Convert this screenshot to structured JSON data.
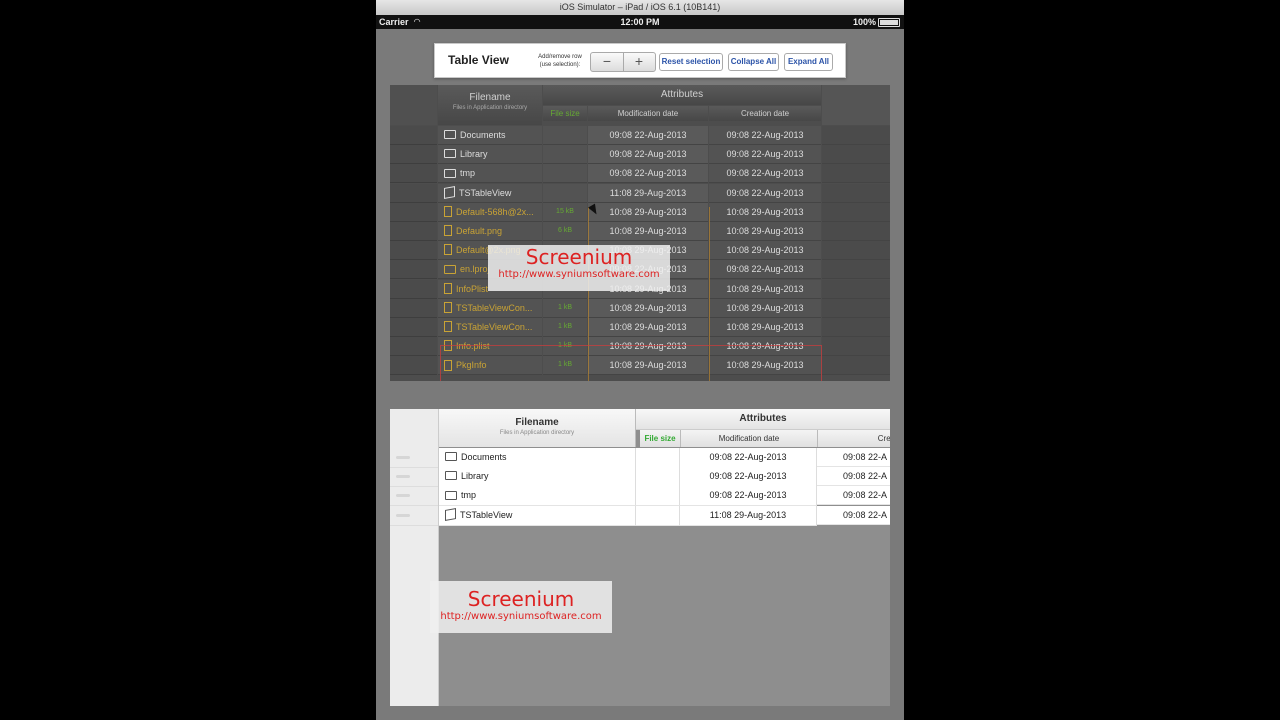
{
  "window": {
    "title": "iOS Simulator – iPad / iOS 6.1 (10B141)"
  },
  "status_bar": {
    "carrier": "Carrier",
    "time": "12:00 PM",
    "battery": "100%"
  },
  "toolbar": {
    "title": "Table View",
    "add_remove_label_1": "Add/remove row",
    "add_remove_label_2": "(use selection):",
    "minus": "−",
    "plus": "+",
    "reset_selection": "Reset selection",
    "collapse_all": "Collapse All",
    "expand_all": "Expand All"
  },
  "table_top": {
    "header_filename": "Filename",
    "header_filename_sub": "Files in Application directory",
    "header_attributes": "Attributes",
    "header_file_size": "File size",
    "header_modification": "Modification date",
    "header_creation": "Creation date",
    "rows": [
      {
        "name": "Documents",
        "icon": "folder-icon",
        "size": "",
        "mod": "09:08  22-Aug-2013",
        "created": "09:08  22-Aug-2013"
      },
      {
        "name": "Library",
        "icon": "folder-icon",
        "size": "",
        "mod": "09:08  22-Aug-2013",
        "created": "09:08  22-Aug-2013"
      },
      {
        "name": "tmp",
        "icon": "folder-icon",
        "size": "",
        "mod": "09:08  22-Aug-2013",
        "created": "09:08  22-Aug-2013"
      },
      {
        "name": "TSTableView",
        "icon": "box-icon",
        "size": "",
        "mod": "11:08  29-Aug-2013",
        "created": "09:08  22-Aug-2013"
      },
      {
        "name": "Default-568h@2x...",
        "icon": "file-icon",
        "size": "15 kB",
        "mod": "10:08  29-Aug-2013",
        "created": "10:08  29-Aug-2013"
      },
      {
        "name": "Default.png",
        "icon": "file-icon",
        "size": "6 kB",
        "mod": "10:08  29-Aug-2013",
        "created": "10:08  29-Aug-2013"
      },
      {
        "name": "Default@2x.png",
        "icon": "file-icon",
        "size": "",
        "mod": "10:08  29-Aug-2013",
        "created": "10:08  29-Aug-2013"
      },
      {
        "name": "en.lproj",
        "icon": "folder-icon",
        "size": "",
        "mod": "09:08  22-Aug-2013",
        "created": "09:08  22-Aug-2013"
      },
      {
        "name": "InfoPlist",
        "icon": "file-icon",
        "size": "",
        "mod": "10:08  29-Aug-2013",
        "created": "10:08  29-Aug-2013"
      },
      {
        "name": "TSTableViewCon...",
        "icon": "file-icon",
        "size": "1 kB",
        "mod": "10:08  29-Aug-2013",
        "created": "10:08  29-Aug-2013"
      },
      {
        "name": "TSTableViewCon...",
        "icon": "file-icon",
        "size": "1 kB",
        "mod": "10:08  29-Aug-2013",
        "created": "10:08  29-Aug-2013"
      },
      {
        "name": "Info.plist",
        "icon": "file-icon",
        "size": "1 kB",
        "mod": "10:08  29-Aug-2013",
        "created": "10:08  29-Aug-2013"
      },
      {
        "name": "PkgInfo",
        "icon": "file-icon",
        "size": "1 kB",
        "mod": "10:08  29-Aug-2013",
        "created": "10:08  29-Aug-2013"
      }
    ]
  },
  "table_bottom": {
    "header_filename": "Filename",
    "header_filename_sub": "Files in Application directory",
    "header_attributes": "Attributes",
    "header_file_size": "File size",
    "header_modification": "Modification date",
    "header_creation": "Creation",
    "rows": [
      {
        "name": "Documents",
        "icon": "folder-icon",
        "mod": "09:08  22-Aug-2013",
        "created": "09:08  22-A"
      },
      {
        "name": "Library",
        "icon": "folder-icon",
        "mod": "09:08  22-Aug-2013",
        "created": "09:08  22-A"
      },
      {
        "name": "tmp",
        "icon": "folder-icon",
        "mod": "09:08  22-Aug-2013",
        "created": "09:08  22-A"
      },
      {
        "name": "TSTableView",
        "icon": "box-icon",
        "mod": "11:08  29-Aug-2013",
        "created": "09:08  22-A"
      }
    ]
  },
  "watermark": {
    "brand": "Screenium",
    "url": "http://www.syniumsoftware.com"
  },
  "colors": {
    "link_blue": "#2b53a8",
    "watermark_red": "#dd2222",
    "file_size_green": "#55aa33"
  }
}
